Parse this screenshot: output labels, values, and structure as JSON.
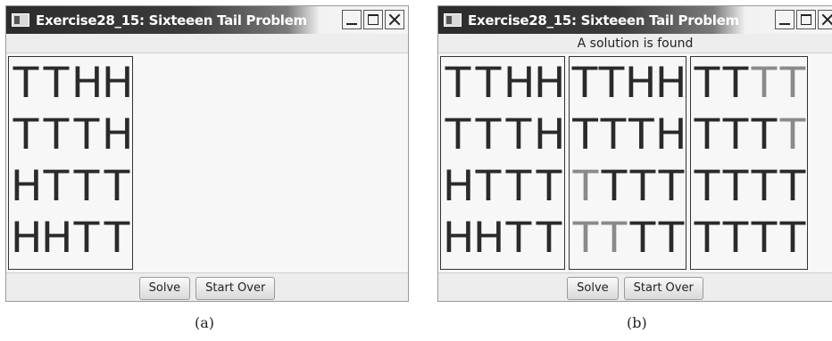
{
  "windows": [
    {
      "title": "Exercise28_15: Sixteeen Tail Problem",
      "status": "",
      "buttons": {
        "solve": "Solve",
        "start_over": "Start Over"
      },
      "caption": "(a)",
      "grids": [
        {
          "rows": [
            [
              "T",
              "T",
              "H",
              "H"
            ],
            [
              "T",
              "T",
              "T",
              "H"
            ],
            [
              "H",
              "T",
              "T",
              "T"
            ],
            [
              "H",
              "H",
              "T",
              "T"
            ]
          ],
          "flipped": [
            [
              0,
              0,
              0,
              0
            ],
            [
              0,
              0,
              0,
              0
            ],
            [
              0,
              0,
              0,
              0
            ],
            [
              0,
              0,
              0,
              0
            ]
          ]
        }
      ]
    },
    {
      "title": "Exercise28_15: Sixteeen Tail Problem",
      "status": "A solution is found",
      "buttons": {
        "solve": "Solve",
        "start_over": "Start Over"
      },
      "caption": "(b)",
      "grids": [
        {
          "rows": [
            [
              "T",
              "T",
              "H",
              "H"
            ],
            [
              "T",
              "T",
              "T",
              "H"
            ],
            [
              "H",
              "T",
              "T",
              "T"
            ],
            [
              "H",
              "H",
              "T",
              "T"
            ]
          ],
          "flipped": [
            [
              0,
              0,
              0,
              0
            ],
            [
              0,
              0,
              0,
              0
            ],
            [
              0,
              0,
              0,
              0
            ],
            [
              0,
              0,
              0,
              0
            ]
          ]
        },
        {
          "rows": [
            [
              "T",
              "T",
              "H",
              "H"
            ],
            [
              "T",
              "T",
              "T",
              "H"
            ],
            [
              "T",
              "T",
              "T",
              "T"
            ],
            [
              "T",
              "T",
              "T",
              "T"
            ]
          ],
          "flipped": [
            [
              0,
              0,
              0,
              0
            ],
            [
              0,
              0,
              0,
              0
            ],
            [
              1,
              0,
              0,
              0
            ],
            [
              1,
              1,
              0,
              0
            ]
          ]
        },
        {
          "rows": [
            [
              "T",
              "T",
              "T",
              "T"
            ],
            [
              "T",
              "T",
              "T",
              "T"
            ],
            [
              "T",
              "T",
              "T",
              "T"
            ],
            [
              "T",
              "T",
              "T",
              "T"
            ]
          ],
          "flipped": [
            [
              0,
              0,
              1,
              1
            ],
            [
              0,
              0,
              0,
              1
            ],
            [
              0,
              0,
              0,
              0
            ],
            [
              0,
              0,
              0,
              0
            ]
          ]
        }
      ]
    }
  ]
}
